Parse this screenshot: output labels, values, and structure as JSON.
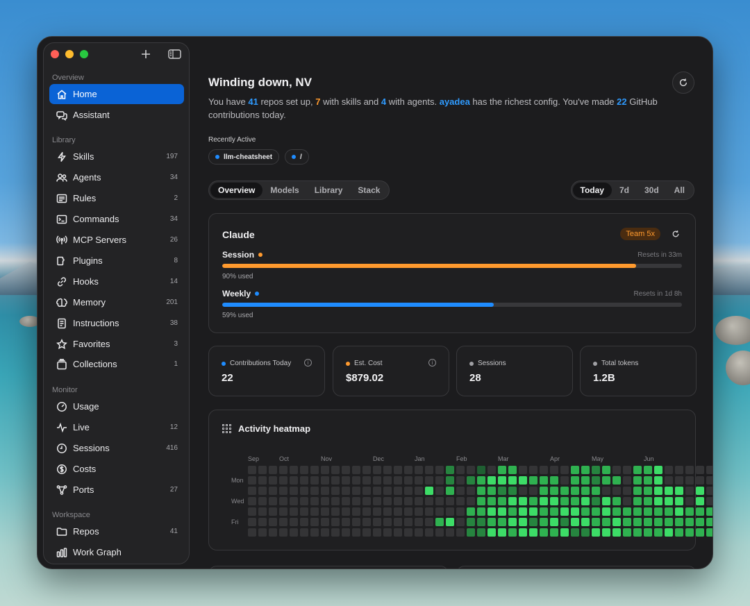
{
  "sidebar": {
    "sections": {
      "overview": "Overview",
      "library": "Library",
      "monitor": "Monitor",
      "workspace": "Workspace"
    },
    "items": [
      {
        "label": "Home",
        "count": ""
      },
      {
        "label": "Assistant",
        "count": ""
      },
      {
        "label": "Skills",
        "count": "197"
      },
      {
        "label": "Agents",
        "count": "34"
      },
      {
        "label": "Rules",
        "count": "2"
      },
      {
        "label": "Commands",
        "count": "34"
      },
      {
        "label": "MCP Servers",
        "count": "26"
      },
      {
        "label": "Plugins",
        "count": "8"
      },
      {
        "label": "Hooks",
        "count": "14"
      },
      {
        "label": "Memory",
        "count": "201"
      },
      {
        "label": "Instructions",
        "count": "38"
      },
      {
        "label": "Favorites",
        "count": "3"
      },
      {
        "label": "Collections",
        "count": "1"
      },
      {
        "label": "Usage",
        "count": ""
      },
      {
        "label": "Live",
        "count": "12"
      },
      {
        "label": "Sessions",
        "count": "416"
      },
      {
        "label": "Costs",
        "count": ""
      },
      {
        "label": "Ports",
        "count": "27"
      },
      {
        "label": "Repos",
        "count": "41"
      },
      {
        "label": "Work Graph",
        "count": ""
      }
    ]
  },
  "header": {
    "title": "Winding down, NV",
    "summary": {
      "p1": "You have ",
      "repos": "41",
      "p2": " repos set up, ",
      "skills": "7",
      "p3": " with skills and ",
      "agents": "4",
      "p4": " with agents. ",
      "richest": "ayadea",
      "p5": " has the richest config. You've made ",
      "contrib": "22",
      "p6": " GitHub contributions today."
    }
  },
  "recently_active": {
    "label": "Recently Active",
    "items": [
      "llm-cheatsheet",
      "/"
    ]
  },
  "tabs": [
    "Overview",
    "Models",
    "Library",
    "Stack"
  ],
  "ranges": [
    "Today",
    "7d",
    "30d",
    "All"
  ],
  "claude": {
    "title": "Claude",
    "plan": "Team 5x",
    "session": {
      "label": "Session",
      "resets": "Resets in 33m",
      "used_text": "90% used",
      "fraction": 0.9,
      "color": "#ff9a2e"
    },
    "weekly": {
      "label": "Weekly",
      "resets": "Resets in 1d 8h",
      "used_text": "59% used",
      "fraction": 0.59,
      "color": "#1f8cff"
    }
  },
  "stats": [
    {
      "label": "Contributions Today",
      "value": "22"
    },
    {
      "label": "Est. Cost",
      "value": "$879.02"
    },
    {
      "label": "Sessions",
      "value": "28"
    },
    {
      "label": "Total tokens",
      "value": "1.2B"
    }
  ],
  "heatmap": {
    "title": "Activity heatmap",
    "months": [
      "Sep",
      "Oct",
      "Nov",
      "Dec",
      "Jan",
      "Feb",
      "Mar",
      "Apr",
      "May",
      "Jun"
    ],
    "days": [
      "Mon",
      "Wed",
      "Fri"
    ],
    "palette": [
      "#343436",
      "#1f5f32",
      "#26843f",
      "#2fb150",
      "#3ddc67"
    ],
    "levels": [
      "00000000000000000002001033000003323003340000044444",
      "00000000000000000002023444433303323303340000044444",
      "00000000000000000403003322003333330003344404044444",
      "00000000000000000000003334434433424303344404044444",
      "00000000000000000000033443443344334333333433344443",
      "00000000000000000034022334423424433433333333343343",
      "00000000000000000000022443443342244433334333343443"
    ]
  }
}
